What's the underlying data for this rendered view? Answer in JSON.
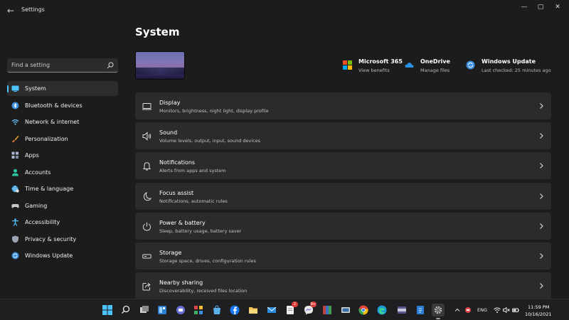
{
  "window": {
    "app_title": "Settings",
    "back_glyph": "←",
    "minimize_glyph": "—",
    "maximize_glyph": "▢",
    "close_glyph": "✕"
  },
  "search": {
    "placeholder": "Find a setting",
    "icon": "search-icon"
  },
  "sidebar": {
    "items": [
      {
        "label": "System",
        "icon": "monitor-icon",
        "selected": true
      },
      {
        "label": "Bluetooth & devices",
        "icon": "bluetooth-icon"
      },
      {
        "label": "Network & internet",
        "icon": "wifi-icon"
      },
      {
        "label": "Personalization",
        "icon": "brush-icon"
      },
      {
        "label": "Apps",
        "icon": "apps-icon"
      },
      {
        "label": "Accounts",
        "icon": "person-icon"
      },
      {
        "label": "Time & language",
        "icon": "globe-clock-icon"
      },
      {
        "label": "Gaming",
        "icon": "gamepad-icon"
      },
      {
        "label": "Accessibility",
        "icon": "accessibility-icon"
      },
      {
        "label": "Privacy & security",
        "icon": "shield-icon"
      },
      {
        "label": "Windows Update",
        "icon": "update-icon"
      }
    ]
  },
  "main": {
    "title": "System",
    "quick_links": [
      {
        "title": "Microsoft 365",
        "subtitle": "View benefits",
        "icon": "microsoft-logo-icon"
      },
      {
        "title": "OneDrive",
        "subtitle": "Manage files",
        "icon": "cloud-icon"
      },
      {
        "title": "Windows Update",
        "subtitle": "Last checked: 25 minutes ago",
        "icon": "update-icon"
      }
    ],
    "cards": [
      {
        "title": "Display",
        "subtitle": "Monitors, brightness, night light, display profile",
        "icon": "display-icon"
      },
      {
        "title": "Sound",
        "subtitle": "Volume levels, output, input, sound devices",
        "icon": "speaker-icon"
      },
      {
        "title": "Notifications",
        "subtitle": "Alerts from apps and system",
        "icon": "bell-icon"
      },
      {
        "title": "Focus assist",
        "subtitle": "Notifications, automatic rules",
        "icon": "moon-icon"
      },
      {
        "title": "Power & battery",
        "subtitle": "Sleep, battery usage, battery saver",
        "icon": "power-icon"
      },
      {
        "title": "Storage",
        "subtitle": "Storage space, drives, configuration rules",
        "icon": "storage-icon"
      },
      {
        "title": "Nearby sharing",
        "subtitle": "Discoverability, received files location",
        "icon": "share-icon"
      }
    ]
  },
  "taskbar": {
    "badges": {
      "mail_count": "2",
      "messenger_count": "9+"
    },
    "language": "ENG",
    "time": "11:59 PM",
    "date": "10/16/2021"
  },
  "colors": {
    "accent": "#4cc2ff",
    "card_bg": "#2b2b2b",
    "window_bg": "#1c1c1c"
  }
}
